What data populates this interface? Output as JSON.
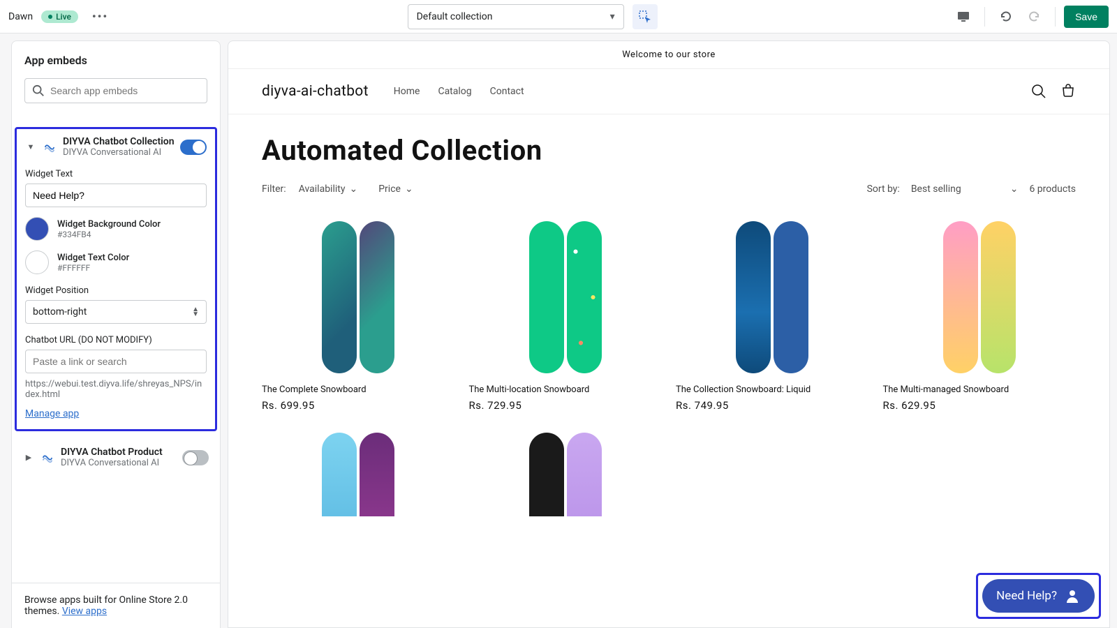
{
  "topbar": {
    "theme_name": "Dawn",
    "live_label": "Live",
    "collection_selected": "Default collection",
    "save_label": "Save"
  },
  "sidebar": {
    "title": "App embeds",
    "search_placeholder": "Search app embeds",
    "embed_collection": {
      "title": "DIYVA Chatbot Collection",
      "subtitle": "DIYVA Conversational AI",
      "toggle_on": true,
      "widget_text_label": "Widget Text",
      "widget_text_value": "Need Help?",
      "bg_color_label": "Widget Background Color",
      "bg_color_hex": "#334FB4",
      "text_color_label": "Widget Text Color",
      "text_color_hex": "#FFFFFF",
      "position_label": "Widget Position",
      "position_value": "bottom-right",
      "url_label": "Chatbot URL (DO NOT MODIFY)",
      "url_placeholder": "Paste a link or search",
      "url_value": "https://webui.test.diyva.life/shreyas_NPS/index.html",
      "manage_link": "Manage app"
    },
    "embed_product": {
      "title": "DIYVA Chatbot Product",
      "subtitle": "DIYVA Conversational AI",
      "toggle_on": false
    },
    "footer_text": "Browse apps built for Online Store 2.0 themes. ",
    "footer_link": "View apps"
  },
  "preview": {
    "announce": "Welcome to our store",
    "store_name": "diyva-ai-chatbot",
    "nav": [
      "Home",
      "Catalog",
      "Contact"
    ],
    "page_title": "Automated Collection",
    "filter_label": "Filter:",
    "filters": [
      "Availability",
      "Price"
    ],
    "sort_label": "Sort by:",
    "sort_value": "Best selling",
    "product_count": "6 products",
    "products": [
      {
        "name": "The Complete Snowboard",
        "price": "Rs. 699.95"
      },
      {
        "name": "The Multi-location Snowboard",
        "price": "Rs. 729.95"
      },
      {
        "name": "The Collection Snowboard: Liquid",
        "price": "Rs. 749.95"
      },
      {
        "name": "The Multi-managed Snowboard",
        "price": "Rs. 629.95"
      }
    ],
    "widget_text": "Need Help?"
  }
}
